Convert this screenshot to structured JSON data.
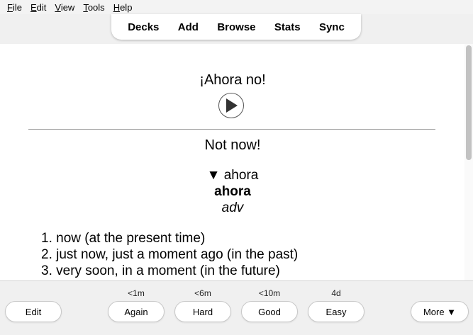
{
  "menu": [
    "File",
    "Edit",
    "View",
    "Tools",
    "Help"
  ],
  "toolbar": {
    "decks": "Decks",
    "add": "Add",
    "browse": "Browse",
    "stats": "Stats",
    "sync": "Sync"
  },
  "card": {
    "front": "¡Ahora no!",
    "back": "Not now!",
    "dict_toggle": "▼ ahora",
    "headword": "ahora",
    "pos": "adv",
    "definitions": [
      "1. now (at the present time)",
      "2. just now, just a moment ago (in the past)",
      "3. very soon, in a moment (in the future)"
    ]
  },
  "answer": {
    "edit": "Edit",
    "again": {
      "label": "Again",
      "due": "<1m"
    },
    "hard": {
      "label": "Hard",
      "due": "<6m"
    },
    "good": {
      "label": "Good",
      "due": "<10m"
    },
    "easy": {
      "label": "Easy",
      "due": "4d"
    },
    "more": "More ▼"
  },
  "colors": {
    "card_bg": "#ffffff",
    "window_bg": "#f0f0f0"
  }
}
